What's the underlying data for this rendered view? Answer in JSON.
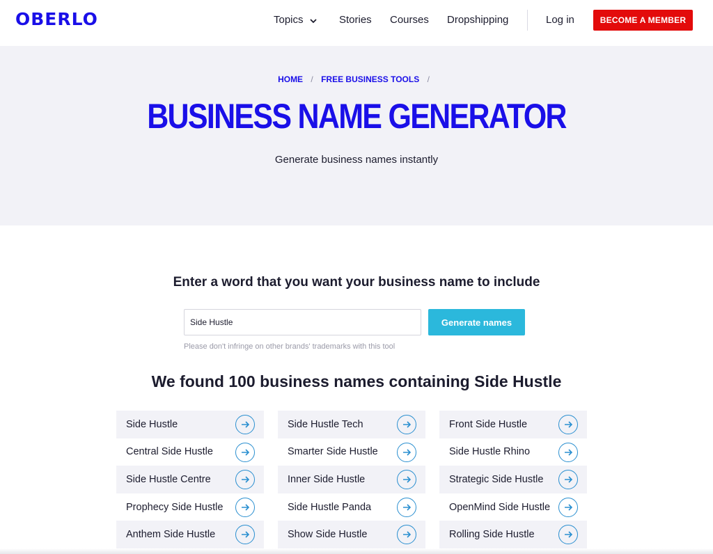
{
  "header": {
    "logo": "OBERLO",
    "nav": {
      "topics": "Topics",
      "stories": "Stories",
      "courses": "Courses",
      "dropshipping": "Dropshipping",
      "login": "Log in"
    },
    "cta": "BECOME A MEMBER"
  },
  "hero": {
    "breadcrumb": [
      "HOME",
      "FREE BUSINESS TOOLS"
    ],
    "breadcrumb_sep": "/",
    "title": "BUSINESS NAME GENERATOR",
    "subtitle": "Generate business names instantly"
  },
  "form": {
    "title": "Enter a word that you want your business name to include",
    "input_value": "Side Hustle",
    "button": "Generate names",
    "disclaimer": "Please don't infringe on other brands' trademarks with this tool"
  },
  "results": {
    "heading": "We found 100 business names containing Side Hustle",
    "columns": [
      [
        "Side Hustle",
        "Central Side Hustle",
        "Side Hustle Centre",
        "Prophecy Side Hustle",
        "Anthem Side Hustle"
      ],
      [
        "Side Hustle Tech",
        "Smarter Side Hustle",
        "Inner Side Hustle",
        "Side Hustle Panda",
        "Show Side Hustle"
      ],
      [
        "Front Side Hustle",
        "Side Hustle Rhino",
        "Strategic Side Hustle",
        "OpenMind Side Hustle",
        "Rolling Side Hustle"
      ]
    ],
    "arrow_icon": "arrow-right-circle-icon"
  },
  "colors": {
    "brand": "#1a0fe8",
    "cta": "#e30b0b",
    "button": "#2bb8dc",
    "hero_bg": "#f2f2f7",
    "arrow": "#2a8fd0"
  }
}
